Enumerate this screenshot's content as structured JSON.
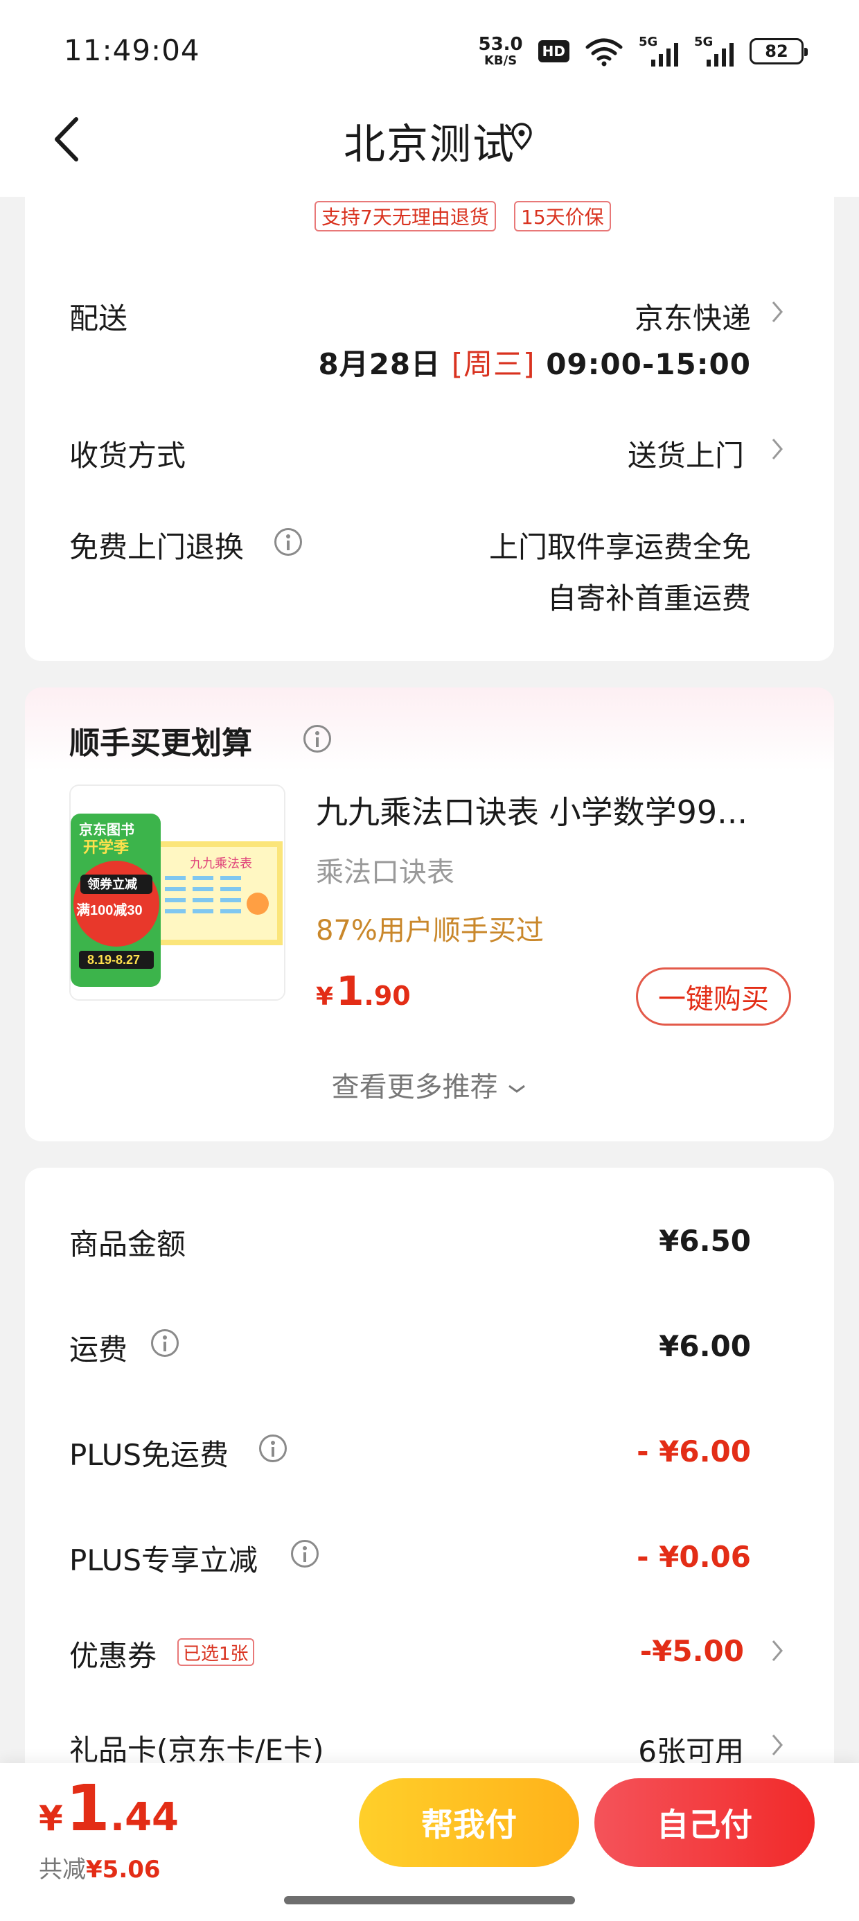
{
  "status_bar": {
    "time": "11:49:04",
    "net_speed": "53.0",
    "net_unit": "KB/S",
    "hd": "HD",
    "sim1": "5G",
    "sim2": "5G",
    "battery": "82"
  },
  "header": {
    "title": "北京测试"
  },
  "tags": [
    "支持7天无理由退货",
    "15天价保"
  ],
  "delivery": {
    "label": "配送",
    "carrier": "京东快递",
    "date": "8月28日",
    "weekday": "[周三]",
    "time_range": "09:00-15:00"
  },
  "receive": {
    "label": "收货方式",
    "value": "送货上门"
  },
  "free_return": {
    "label": "免费上门退换",
    "line1": "上门取件享运费全免",
    "line2": "自寄补首重运费"
  },
  "recommend": {
    "title": "顺手买更划算",
    "product": {
      "name": "九九乘法口诀表 小学数学99...",
      "sub": "乘法口诀表",
      "bought": "87%用户顺手买过",
      "price_symbol": "¥",
      "price_int": "1",
      "price_dec": ".90",
      "buy_label": "一键购买",
      "img_title_1": "京东图书",
      "img_title_2": "开学季",
      "img_coupon_1": "领券立减",
      "img_coupon_2": "满100减30",
      "img_date": "8.19-8.27",
      "img_poster": "九九乘法表"
    },
    "more": "查看更多推荐"
  },
  "amounts": {
    "goods_label": "商品金额",
    "goods_value": "¥6.50",
    "freight_label": "运费",
    "freight_value": "¥6.00",
    "plus_free_label": "PLUS免运费",
    "plus_free_value": "- ¥6.00",
    "plus_cut_label": "PLUS专享立减",
    "plus_cut_value": "- ¥0.06",
    "coupon_label": "优惠券",
    "coupon_badge": "已选1张",
    "coupon_value": "-¥5.00",
    "giftcard_label": "礼品卡(京东卡/E卡)",
    "giftcard_value": "6张可用"
  },
  "bottom": {
    "total_symbol": "¥",
    "total_int": "1",
    "total_dec": ".44",
    "saved_label": "共减",
    "saved_value": "¥5.06",
    "help_pay": "帮我付",
    "self_pay": "自己付"
  },
  "colors": {
    "accent_red": "#e32d16",
    "help_btn": "#ffb21a",
    "self_btn": "#f22a2a"
  }
}
